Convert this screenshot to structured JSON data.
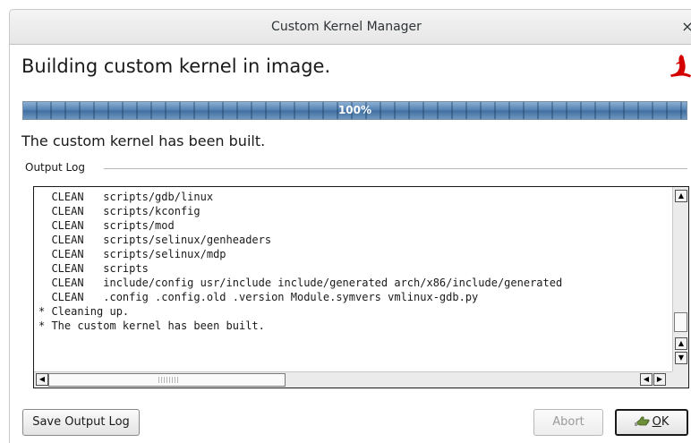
{
  "window": {
    "title": "Custom Kernel Manager",
    "close_glyph": "×"
  },
  "header": {
    "heading": "Building custom kernel in image.",
    "logo_icon": "red-hat-shadowman-icon",
    "logo_color": "#d40000"
  },
  "progress": {
    "value": 1.0,
    "label": "100%"
  },
  "status": {
    "text": "The custom kernel has been built."
  },
  "output_log": {
    "frame_label": "Output Log",
    "lines": [
      "  CLEAN   scripts/gdb/linux",
      "  CLEAN   scripts/kconfig",
      "  CLEAN   scripts/mod",
      "  CLEAN   scripts/selinux/genheaders",
      "  CLEAN   scripts/selinux/mdp",
      "  CLEAN   scripts",
      "  CLEAN   include/config usr/include include/generated arch/x86/include/generated",
      "  CLEAN   .config .config.old .version Module.symvers vmlinux-gdb.py",
      "* Cleaning up.",
      "* The custom kernel has been built."
    ]
  },
  "buttons": {
    "save_log": "Save Output Log",
    "abort": "Abort",
    "ok_label_mnemonic": "O",
    "ok_label_rest": "K",
    "ok_icon": "ok-hand-icon"
  }
}
